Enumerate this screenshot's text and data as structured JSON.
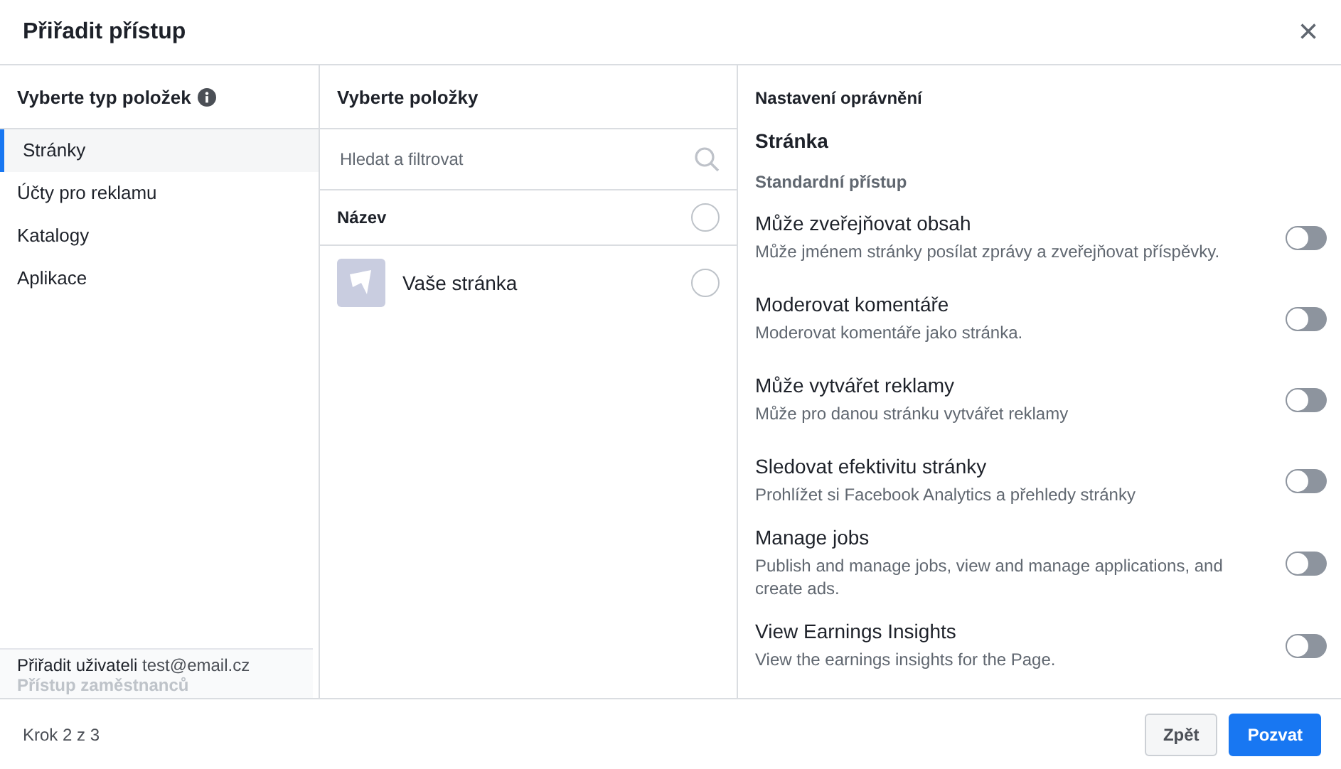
{
  "dialog": {
    "title": "Přiřadit přístup",
    "close_label": "×"
  },
  "item_types": {
    "heading": "Vyberte typ položek",
    "items": [
      {
        "label": "Stránky",
        "selected": true
      },
      {
        "label": "Účty pro reklamu",
        "selected": false
      },
      {
        "label": "Katalogy",
        "selected": false
      },
      {
        "label": "Aplikace",
        "selected": false
      }
    ],
    "assign_label": "Přiřadit uživateli",
    "assign_email": "test@email.cz",
    "access_label": "Přístup zaměstnanců"
  },
  "items": {
    "heading": "Vyberte položky",
    "search": {
      "placeholder": "Hledat a filtrovat"
    },
    "column_header": "Název",
    "header_selected": false,
    "rows": [
      {
        "name": "Vaše stránka",
        "selected": false
      }
    ]
  },
  "permissions": {
    "heading": "Nastavení oprávnění",
    "section": "Stránka",
    "group": "Standardní přístup",
    "items": [
      {
        "title": "Může zveřejňovat obsah",
        "description": "Může jménem stránky posílat zprávy a zveřejňovat příspěvky.",
        "on": false
      },
      {
        "title": "Moderovat komentáře",
        "description": "Moderovat komentáře jako stránka.",
        "on": false
      },
      {
        "title": "Může vytvářet reklamy",
        "description": "Může pro danou stránku vytvářet reklamy",
        "on": false
      },
      {
        "title": "Sledovat efektivitu stránky",
        "description": "Prohlížet si Facebook Analytics a přehledy stránky",
        "on": false
      },
      {
        "title": "Manage jobs",
        "description": "Publish and manage jobs, view and manage applications, and create ads.",
        "on": false
      },
      {
        "title": "View Earnings Insights",
        "description": "View the earnings insights for the Page.",
        "on": false
      }
    ]
  },
  "footer": {
    "step": "Krok 2 z 3",
    "buttons": [
      {
        "label": "Zpět",
        "kind": "secondary"
      },
      {
        "label": "Pozvat",
        "kind": "primary"
      }
    ]
  }
}
